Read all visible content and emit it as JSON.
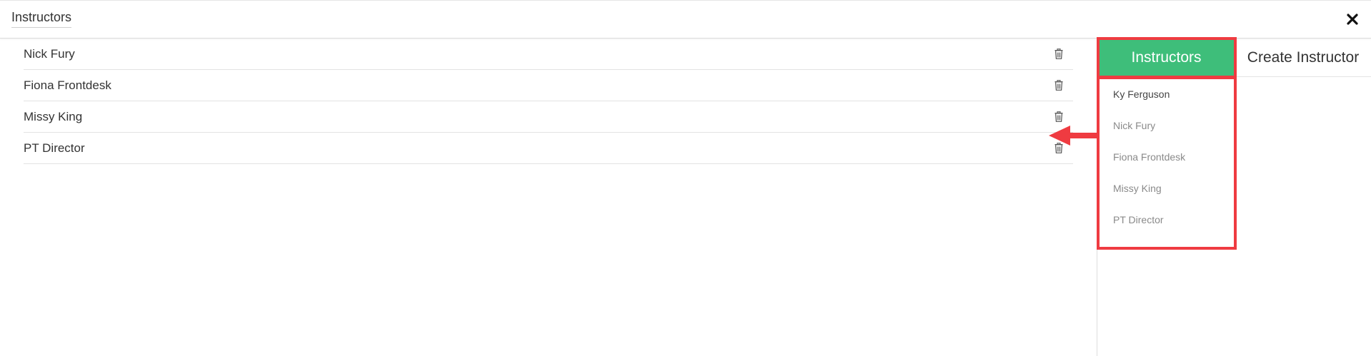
{
  "header": {
    "title": "Instructors",
    "close_icon": "close-icon"
  },
  "instructor_list": {
    "rows": [
      {
        "name": "Nick Fury"
      },
      {
        "name": "Fiona Frontdesk"
      },
      {
        "name": "Missy King"
      },
      {
        "name": "PT Director"
      }
    ],
    "row_action_icon": "trash-icon"
  },
  "side_panel": {
    "tabs": [
      {
        "label": "Instructors",
        "active": true
      },
      {
        "label": "Create Instructor",
        "active": false
      }
    ],
    "dropdown_items": [
      {
        "label": "Ky Ferguson"
      },
      {
        "label": "Nick Fury"
      },
      {
        "label": "Fiona Frontdesk"
      },
      {
        "label": "Missy King"
      },
      {
        "label": "PT Director"
      }
    ]
  },
  "annotation": {
    "highlight_color": "#ef3b41",
    "arrow_icon": "arrow-left-icon"
  },
  "colors": {
    "active_tab": "#3ebe7a",
    "highlight": "#ef3b41"
  }
}
